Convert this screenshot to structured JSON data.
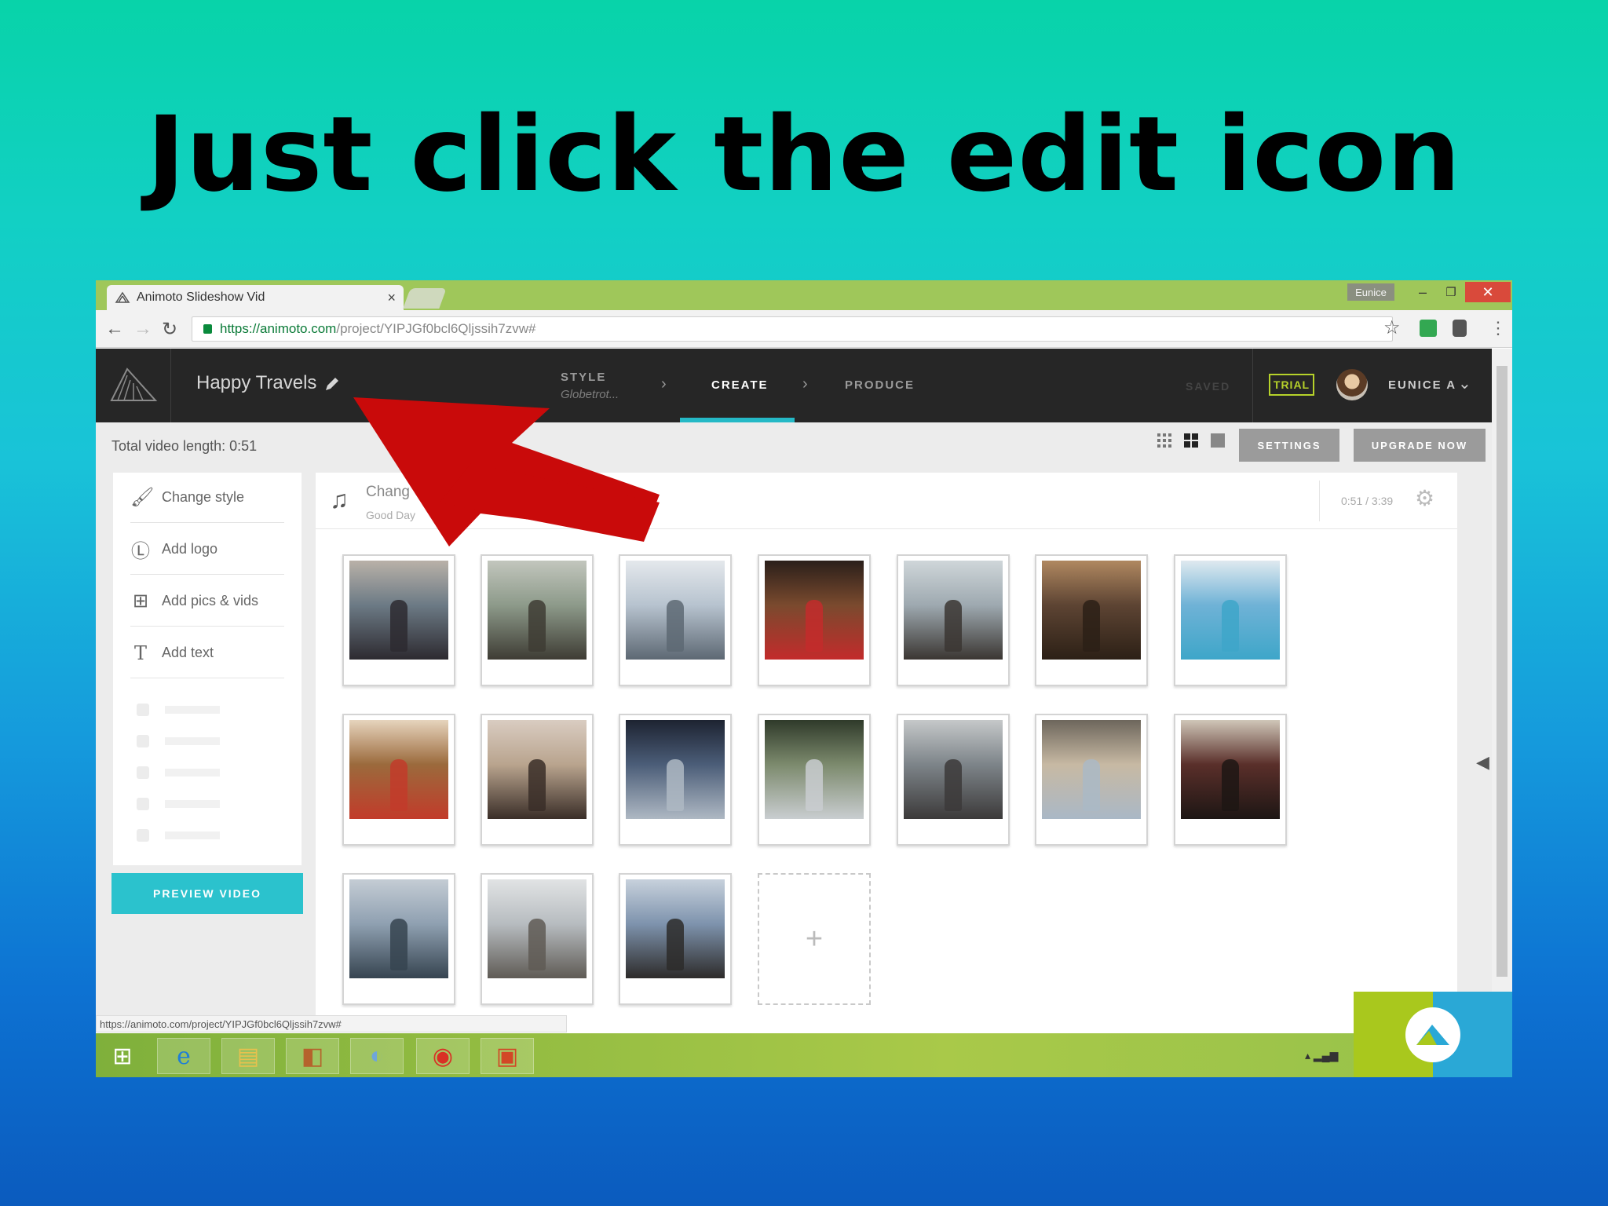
{
  "slide": {
    "title": "Just click the edit icon"
  },
  "browser": {
    "tab_title": "Animoto Slideshow Vid",
    "tab_close": "×",
    "window_user": "Eunice",
    "win_min": "–",
    "win_restore": "❐",
    "win_close": "✕",
    "back": "←",
    "forward": "→",
    "reload": "↻",
    "url_host": "https://animoto.com",
    "url_path": "/project/YIPJGf0bcl6Qljssih7zvw#",
    "star": "☆",
    "menu": "⋮",
    "status_url": "https://animoto.com/project/YIPJGf0bcl6Qljssih7zvw#"
  },
  "app": {
    "project_title": "Happy Travels",
    "steps": [
      {
        "label": "STYLE",
        "sub": "Globetrot..."
      },
      {
        "label": "CREATE"
      },
      {
        "label": "PRODUCE"
      }
    ],
    "step_chevron": "›",
    "saved": "SAVED",
    "trial": "TRIAL",
    "user": "EUNICE A",
    "user_chevron": "⌄",
    "video_length": "Total video length: 0:51",
    "settings": "SETTINGS",
    "upgrade": "UPGRADE NOW"
  },
  "sidebar": {
    "items": [
      {
        "label": "Change style",
        "icon": "paintbrush-icon",
        "glyph": "🖌"
      },
      {
        "label": "Add logo",
        "icon": "logo-icon",
        "glyph": "Ⓛ"
      },
      {
        "label": "Add pics & vids",
        "icon": "add-media-icon",
        "glyph": "⊞"
      },
      {
        "label": "Add text",
        "icon": "text-icon",
        "glyph": "T"
      }
    ],
    "preview_button": "PREVIEW VIDEO"
  },
  "music": {
    "icon": "♫",
    "song": "Chang",
    "artist": "Good Day",
    "time": "0:51 / 3:39",
    "gear": "⚙"
  },
  "gallery": {
    "photos": [
      {
        "name": "friends-city-square",
        "colors": [
          "#6c7a85",
          "#2d2a30",
          "#b9b1a8"
        ]
      },
      {
        "name": "woman-bridge-railing",
        "colors": [
          "#8d9a8a",
          "#3e3c34",
          "#c2c6bd"
        ]
      },
      {
        "name": "tower-bridge",
        "colors": [
          "#b7c3cf",
          "#5d6873",
          "#e4e8ec"
        ]
      },
      {
        "name": "royal-guard-photo",
        "colors": [
          "#7a4a2e",
          "#c32b2b",
          "#2a1f1a"
        ]
      },
      {
        "name": "woman-fountain",
        "colors": [
          "#9ea9b0",
          "#3b3632",
          "#cfd6d9"
        ]
      },
      {
        "name": "market-street",
        "colors": [
          "#5d4433",
          "#2c2016",
          "#b08860"
        ]
      },
      {
        "name": "pool-highrise",
        "colors": [
          "#6fb2d6",
          "#3ea6c9",
          "#dfe9ef"
        ]
      },
      {
        "name": "woman-wooden-sign",
        "colors": [
          "#9b6a3c",
          "#c23b2a",
          "#e6d4bd"
        ]
      },
      {
        "name": "selfie-two-women",
        "colors": [
          "#b9a48e",
          "#3a2e28",
          "#d9ccc1"
        ]
      },
      {
        "name": "petronas-towers",
        "colors": [
          "#4b5d78",
          "#aeb8c3",
          "#1d2331"
        ]
      },
      {
        "name": "christmas-tree-mall",
        "colors": [
          "#7c8a6d",
          "#c9cdd0",
          "#2f3a2a"
        ]
      },
      {
        "name": "fountain-statue",
        "colors": [
          "#7d8489",
          "#3c3a3a",
          "#c5c8c9"
        ]
      },
      {
        "name": "milan-cathedral",
        "colors": [
          "#c7b9a3",
          "#aab8c6",
          "#6d665c"
        ]
      },
      {
        "name": "dinner-table",
        "colors": [
          "#5a2f2a",
          "#1d1614",
          "#cfc6b8"
        ]
      },
      {
        "name": "harbor-boats",
        "colors": [
          "#8fa0b1",
          "#364450",
          "#c4ccd4"
        ]
      },
      {
        "name": "eiffel-tower",
        "colors": [
          "#b7bcc0",
          "#5f5b55",
          "#e1e3e4"
        ]
      },
      {
        "name": "street-sign-city",
        "colors": [
          "#7e93ad",
          "#2d2b2a",
          "#c7d1dc"
        ]
      }
    ],
    "add_label": "+"
  },
  "taskbar": {
    "items": [
      "windows-start-icon",
      "internet-explorer-icon",
      "file-explorer-icon",
      "folder-app-icon",
      "paint-icon",
      "chrome-icon",
      "powerpoint-icon"
    ],
    "glyphs": [
      "⊞",
      "e",
      "▤",
      "◧",
      "◐",
      "◉",
      "▣"
    ]
  },
  "colors": {
    "accent": "#25b9c6",
    "trial": "#b6d22a",
    "arrow": "#cc0000",
    "app_header": "#262626"
  }
}
